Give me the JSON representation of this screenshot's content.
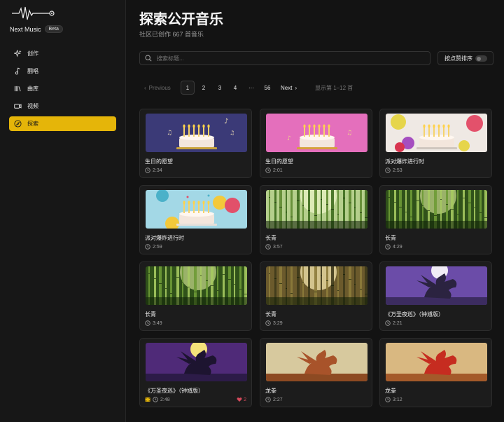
{
  "brand": {
    "name": "Next Music",
    "badge": "Beta"
  },
  "nav": [
    {
      "icon": "sparkles-icon",
      "label": "创作",
      "active": false
    },
    {
      "icon": "music-note-icon",
      "label": "翻唱",
      "active": false
    },
    {
      "icon": "library-icon",
      "label": "曲库",
      "active": false
    },
    {
      "icon": "video-icon",
      "label": "视频",
      "active": false
    },
    {
      "icon": "compass-icon",
      "label": "探索",
      "active": true
    }
  ],
  "page": {
    "title": "探索公开音乐",
    "subtitle": "社区已创作 667 首音乐"
  },
  "search": {
    "placeholder": "搜索标题...",
    "value": ""
  },
  "sort": {
    "label": "按点赞排序",
    "enabled": false
  },
  "pagination": {
    "previous": "Previous",
    "pages": [
      "1",
      "2",
      "3",
      "4"
    ],
    "ellipsis": "···",
    "last": "56",
    "next": "Next",
    "current": "1",
    "info": "显示第 1–12 首"
  },
  "colors": {
    "accent": "#e5b509",
    "like": "#d74a5c"
  },
  "cards": [
    {
      "title": "生日的愿望",
      "duration": "2:34",
      "art": "birthday-night"
    },
    {
      "title": "生日的愿望",
      "duration": "2:01",
      "art": "birthday-pink"
    },
    {
      "title": "派对爆炸进行时",
      "duration": "2:53",
      "art": "party-cake"
    },
    {
      "title": "派对爆炸进行时",
      "duration": "2:59",
      "art": "party-cake-blue"
    },
    {
      "title": "长青",
      "duration": "3:57",
      "art": "bamboo-light"
    },
    {
      "title": "长青",
      "duration": "4:29",
      "art": "bamboo-green"
    },
    {
      "title": "长青",
      "duration": "3:49",
      "art": "bamboo-green"
    },
    {
      "title": "长青",
      "duration": "3:29",
      "art": "bamboo-sun"
    },
    {
      "title": "《万圣夜巡》（钟馗版）",
      "duration": "2:21",
      "art": "dragon-moon"
    },
    {
      "title": "《万圣夜巡》（钟馗版）",
      "duration": "2:48",
      "art": "dragon-purple",
      "has_video_icon": true,
      "likes": "2"
    },
    {
      "title": "龙拳",
      "duration": "2:27",
      "art": "dragon-orange"
    },
    {
      "title": "龙拳",
      "duration": "3:12",
      "art": "dragon-red"
    }
  ]
}
